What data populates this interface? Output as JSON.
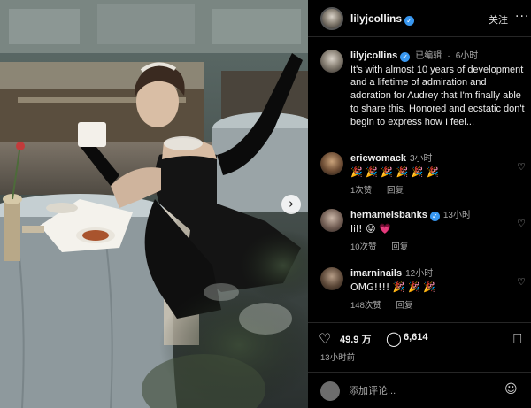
{
  "post": {
    "username": "lilyjcollins",
    "follow_label": "关注",
    "more_glyph": "···",
    "caption": {
      "username": "lilyjcollins",
      "edited_label": "已编辑",
      "separator": "·",
      "time": "6小时",
      "text": "It's with almost 10 years of development and a lifetime of admiration and adoration for Audrey that I'm finally able to share this. Honored and ecstatic don't begin to express how I feel..."
    },
    "comments": [
      {
        "username": "ericwomack",
        "time": "3小时",
        "text": "🎉 🎉 🎉 🎉 🎉 🎉",
        "likes": "1次赞",
        "reply_label": "回复"
      },
      {
        "username": "hernameisbanks",
        "time": "13小时",
        "text": "lil! 😝 💗",
        "likes": "10次赞",
        "reply_label": "回复"
      },
      {
        "username": "imarninails",
        "time": "12小时",
        "text": "OMG!!!! 🎉 🎉 🎉",
        "likes": "148次赞",
        "reply_label": "回复"
      }
    ],
    "likes_count": "49.9 万",
    "comments_count": "6,614",
    "posted_time": "13小时前",
    "comment_placeholder": "添加评论...",
    "icons": {
      "verified": "verified-badge-icon",
      "like": "heart-icon",
      "comment": "comment-bubble-icon",
      "share": "send-icon",
      "save": "bookmark-icon",
      "emoji": "emoji-icon",
      "next": "chevron-right-icon"
    },
    "colors": {
      "verified": "#3897f0",
      "background": "#000000",
      "muted": "#a8a8a8"
    }
  }
}
